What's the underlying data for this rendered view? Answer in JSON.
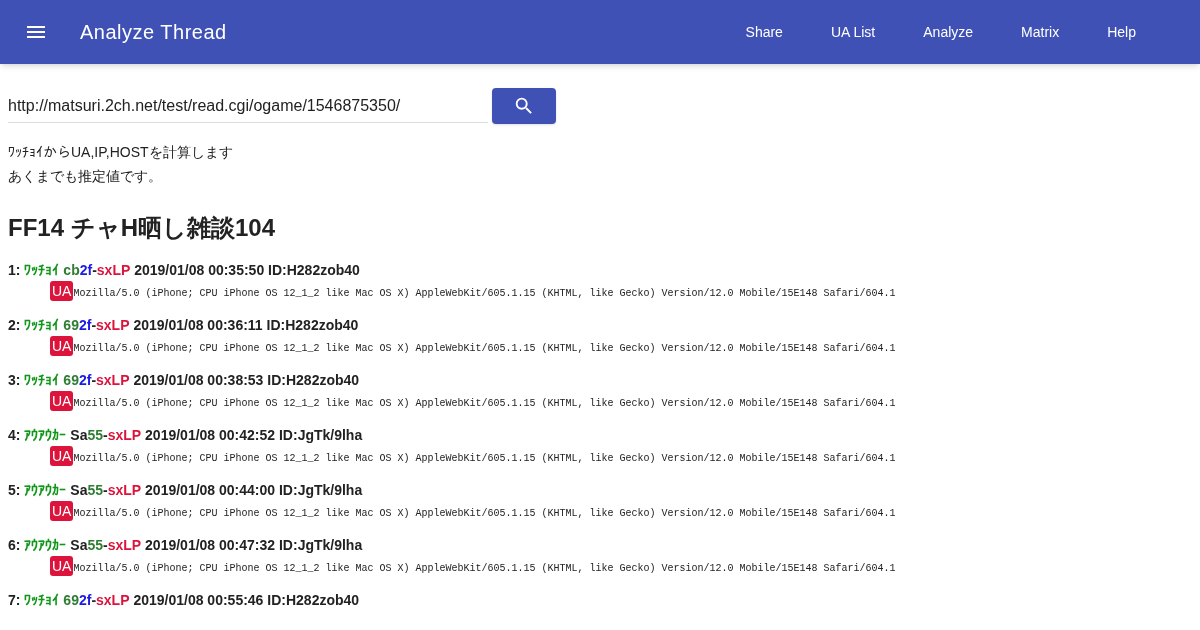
{
  "app_bar": {
    "title": "Analyze Thread",
    "nav": [
      "Share",
      "UA List",
      "Analyze",
      "Matrix",
      "Help"
    ]
  },
  "url_field": {
    "value": "http://matsuri.2ch.net/test/read.cgi/ogame/1546875350/"
  },
  "description": [
    "ﾜｯﾁｮｲからUA,IP,HOSTを計算します",
    "あくまでも推定値です。"
  ],
  "thread_title": "FF14 チャH晒し雑談104",
  "posts": [
    {
      "number": "1:",
      "segments": [
        {
          "text": "ﾜｯﾁｮｲ",
          "color": "#11961a"
        },
        {
          "text": "cb",
          "color": "#2e7d32"
        },
        {
          "text": "2f",
          "color": "#1a1ae6"
        },
        {
          "text": "-",
          "color": "#222222"
        },
        {
          "text": "sxLP",
          "color": "#dc143c"
        }
      ],
      "date": "2019/01/08 00:35:50",
      "id": "ID:H282zob40",
      "badge": "UA",
      "ua": "Mozilla/5.0 (iPhone; CPU iPhone OS 12_1_2 like Mac OS X) AppleWebKit/605.1.15 (KHTML, like Gecko) Version/12.0 Mobile/15E148 Safari/604.1"
    },
    {
      "number": "2:",
      "segments": [
        {
          "text": "ﾜｯﾁｮｲ",
          "color": "#11961a"
        },
        {
          "text": "69",
          "color": "#2e7d32"
        },
        {
          "text": "2f",
          "color": "#1a1ae6"
        },
        {
          "text": "-",
          "color": "#222222"
        },
        {
          "text": "sxLP",
          "color": "#dc143c"
        }
      ],
      "date": "2019/01/08 00:36:11",
      "id": "ID:H282zob40",
      "badge": "UA",
      "ua": "Mozilla/5.0 (iPhone; CPU iPhone OS 12_1_2 like Mac OS X) AppleWebKit/605.1.15 (KHTML, like Gecko) Version/12.0 Mobile/15E148 Safari/604.1"
    },
    {
      "number": "3:",
      "segments": [
        {
          "text": "ﾜｯﾁｮｲ",
          "color": "#11961a"
        },
        {
          "text": "69",
          "color": "#2e7d32"
        },
        {
          "text": "2f",
          "color": "#1a1ae6"
        },
        {
          "text": "-",
          "color": "#222222"
        },
        {
          "text": "sxLP",
          "color": "#dc143c"
        }
      ],
      "date": "2019/01/08 00:38:53",
      "id": "ID:H282zob40",
      "badge": "UA",
      "ua": "Mozilla/5.0 (iPhone; CPU iPhone OS 12_1_2 like Mac OS X) AppleWebKit/605.1.15 (KHTML, like Gecko) Version/12.0 Mobile/15E148 Safari/604.1"
    },
    {
      "number": "4:",
      "segments": [
        {
          "text": "ｱｳｱｳｶｰ",
          "color": "#11961a"
        },
        {
          "text": "Sa",
          "color": "#222222"
        },
        {
          "text": "55",
          "color": "#2e7d32"
        },
        {
          "text": "-",
          "color": "#222222"
        },
        {
          "text": "sxLP",
          "color": "#dc143c"
        }
      ],
      "date": "2019/01/08 00:42:52",
      "id": "ID:JgTk/9lha",
      "badge": "UA",
      "ua": "Mozilla/5.0 (iPhone; CPU iPhone OS 12_1_2 like Mac OS X) AppleWebKit/605.1.15 (KHTML, like Gecko) Version/12.0 Mobile/15E148 Safari/604.1"
    },
    {
      "number": "5:",
      "segments": [
        {
          "text": "ｱｳｱｳｶｰ",
          "color": "#11961a"
        },
        {
          "text": "Sa",
          "color": "#222222"
        },
        {
          "text": "55",
          "color": "#2e7d32"
        },
        {
          "text": "-",
          "color": "#222222"
        },
        {
          "text": "sxLP",
          "color": "#dc143c"
        }
      ],
      "date": "2019/01/08 00:44:00",
      "id": "ID:JgTk/9lha",
      "badge": "UA",
      "ua": "Mozilla/5.0 (iPhone; CPU iPhone OS 12_1_2 like Mac OS X) AppleWebKit/605.1.15 (KHTML, like Gecko) Version/12.0 Mobile/15E148 Safari/604.1"
    },
    {
      "number": "6:",
      "segments": [
        {
          "text": "ｱｳｱｳｶｰ",
          "color": "#11961a"
        },
        {
          "text": "Sa",
          "color": "#222222"
        },
        {
          "text": "55",
          "color": "#2e7d32"
        },
        {
          "text": "-",
          "color": "#222222"
        },
        {
          "text": "sxLP",
          "color": "#dc143c"
        }
      ],
      "date": "2019/01/08 00:47:32",
      "id": "ID:JgTk/9lha",
      "badge": "UA",
      "ua": "Mozilla/5.0 (iPhone; CPU iPhone OS 12_1_2 like Mac OS X) AppleWebKit/605.1.15 (KHTML, like Gecko) Version/12.0 Mobile/15E148 Safari/604.1"
    },
    {
      "number": "7:",
      "segments": [
        {
          "text": "ﾜｯﾁｮｲ",
          "color": "#11961a"
        },
        {
          "text": "69",
          "color": "#2e7d32"
        },
        {
          "text": "2f",
          "color": "#1a1ae6"
        },
        {
          "text": "-",
          "color": "#222222"
        },
        {
          "text": "sxLP",
          "color": "#dc143c"
        }
      ],
      "date": "2019/01/08 00:55:46",
      "id": "ID:H282zob40"
    }
  ]
}
